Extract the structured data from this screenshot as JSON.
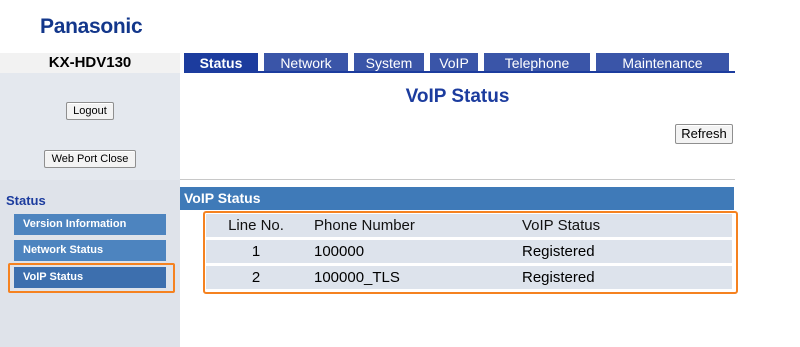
{
  "header": {
    "brand": "Panasonic",
    "model": "KX-HDV130"
  },
  "tabs": [
    {
      "label": "Status",
      "active": true
    },
    {
      "label": "Network",
      "active": false
    },
    {
      "label": "System",
      "active": false
    },
    {
      "label": "VoIP",
      "active": false
    },
    {
      "label": "Telephone",
      "active": false
    },
    {
      "label": "Maintenance",
      "active": false
    }
  ],
  "sidebar": {
    "logout_label": "Logout",
    "webport_label": "Web Port Close",
    "section_heading": "Status",
    "items": [
      {
        "label": "Version Information"
      },
      {
        "label": "Network Status"
      },
      {
        "label": "VoIP Status",
        "selected": true
      }
    ]
  },
  "main": {
    "title": "VoIP Status",
    "refresh_label": "Refresh",
    "section_title": "VoIP Status",
    "table": {
      "headers": [
        "Line No.",
        "Phone Number",
        "VoIP Status"
      ],
      "rows": [
        [
          "1",
          "100000",
          "Registered"
        ],
        [
          "2",
          "100000_TLS",
          "Registered"
        ]
      ]
    }
  },
  "colors": {
    "brand": "#13378b",
    "tab": "#3a55a8",
    "tab_active": "#1c3c9e",
    "nav_item": "#4d84bf",
    "section_bar": "#3f7ab8",
    "highlight": "#f58220"
  }
}
